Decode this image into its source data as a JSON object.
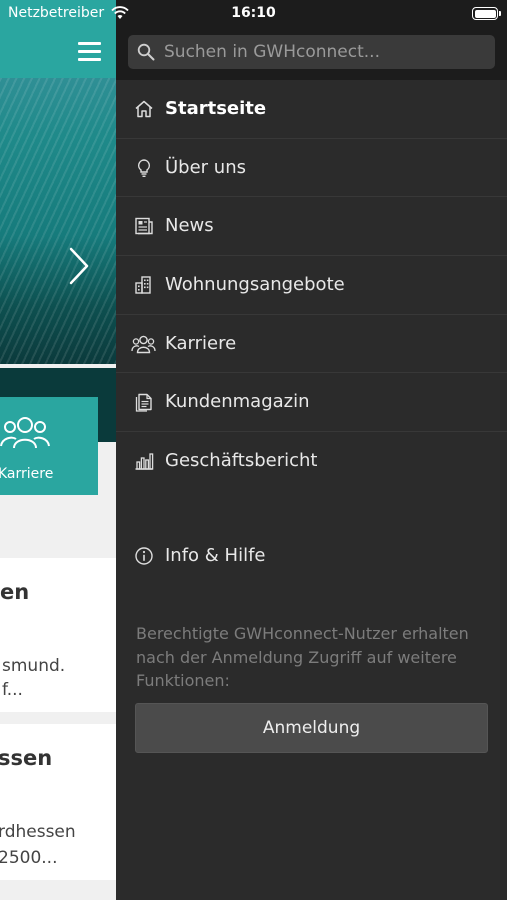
{
  "status_bar": {
    "carrier": "Netzbetreiber",
    "time": "16:10",
    "battery_level": 1.0
  },
  "background_app": {
    "tile_label": "Karriere",
    "cards": [
      {
        "title_fragment": "en",
        "lines": [
          "smund.",
          "f..."
        ]
      },
      {
        "title_fragment": "ssen",
        "lines": [
          "rdhessen",
          "2500..."
        ]
      }
    ],
    "accent_color": "#2aa6a0"
  },
  "drawer": {
    "search": {
      "placeholder": "Suchen in GWHconnect...",
      "value": ""
    },
    "menu": [
      {
        "label": "Startseite",
        "icon": "home-icon",
        "active": true
      },
      {
        "label": "Über uns",
        "icon": "lightbulb-icon",
        "active": false
      },
      {
        "label": "News",
        "icon": "newspaper-icon",
        "active": false
      },
      {
        "label": "Wohnungsangebote",
        "icon": "buildings-icon",
        "active": false
      },
      {
        "label": "Karriere",
        "icon": "people-icon",
        "active": false
      },
      {
        "label": "Kundenmagazin",
        "icon": "magazine-icon",
        "active": false
      },
      {
        "label": "Geschäftsbericht",
        "icon": "bar-chart-icon",
        "active": false
      }
    ],
    "info": {
      "label": "Info & Hilfe",
      "icon": "info-icon"
    },
    "login_text": "Berechtigte GWHconnect-Nutzer erhalten nach der Anmeldung Zugriff auf weitere Funktionen:",
    "login_button": "Anmeldung",
    "background_color": "#2b2b2b"
  }
}
